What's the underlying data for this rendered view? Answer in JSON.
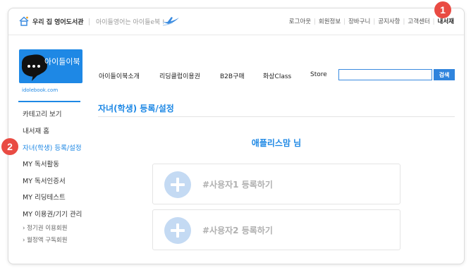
{
  "topbar": {
    "site_name": "우리 집 영어도서관",
    "slogan": "아이들영어는 아이들e북 !",
    "links": [
      "로그아웃",
      "회원정보",
      "장바구니",
      "공지사항",
      "고객센터",
      "내서재"
    ]
  },
  "badges": [
    "1",
    "2"
  ],
  "logo": {
    "text": "아이들이북",
    "domain": "idolebook.com"
  },
  "nav": {
    "items": [
      "아이들이북소개",
      "리딩클럽이용권",
      "B2B구매",
      "화상Class",
      "Store"
    ],
    "search_placeholder": "",
    "search_button": "검색"
  },
  "sidebar": {
    "items": [
      "카테고리 보기",
      "내서재 홈",
      "자녀(학생) 등록/설정",
      "MY 독서활동",
      "MY 독서인증서",
      "MY 리딩테스트",
      "MY 이용권/기기 관리"
    ],
    "active_index": 2,
    "sub_items": [
      "정기권 이용회원",
      "월정액 구독회원"
    ]
  },
  "main": {
    "title": "자녀(학생) 등록/설정",
    "user_name": "애플리스맘 님",
    "register_cards": [
      "#사용자1 등록하기",
      "#사용자2 등록하기"
    ]
  },
  "colors": {
    "accent": "#1e88e5",
    "badge": "#e94b43",
    "plus_circle": "#c4daf3"
  }
}
